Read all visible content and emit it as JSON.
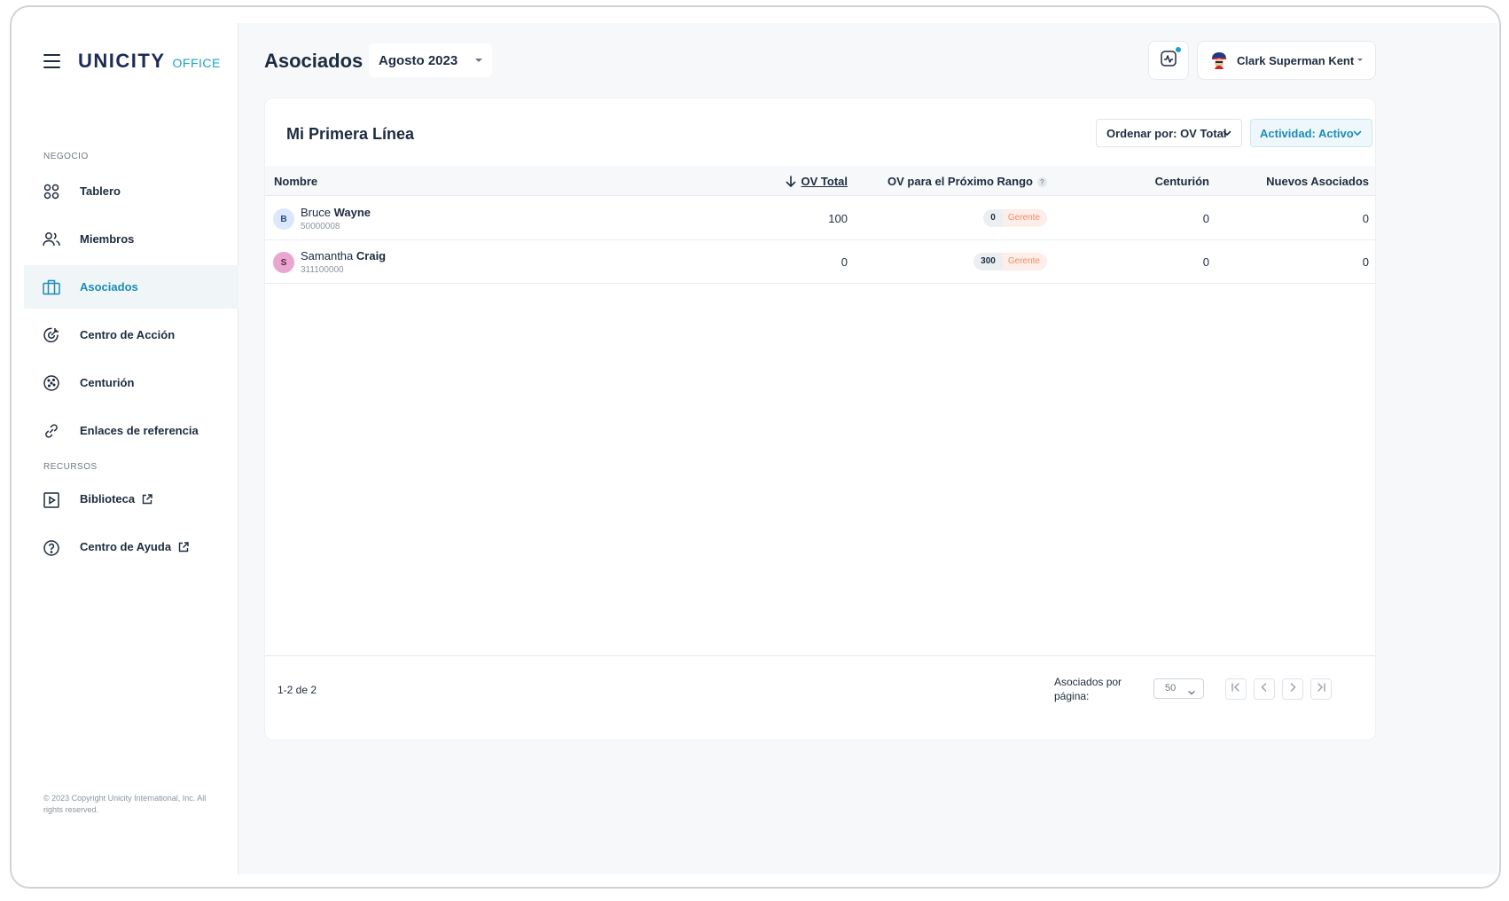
{
  "brand": {
    "name": "UNICITY",
    "product": "OFFICE"
  },
  "sidebar": {
    "sections": [
      {
        "label": "NEGOCIO"
      },
      {
        "label": "RECURSOS"
      }
    ],
    "items": [
      {
        "label": "Tablero",
        "icon": "dashboard-icon"
      },
      {
        "label": "Miembros",
        "icon": "members-icon"
      },
      {
        "label": "Asociados",
        "icon": "briefcase-icon",
        "active": true
      },
      {
        "label": "Centro de Acción",
        "icon": "target-icon"
      },
      {
        "label": "Centurión",
        "icon": "cookie-icon"
      },
      {
        "label": "Enlaces de referencia",
        "icon": "link-icon"
      },
      {
        "label": "Biblioteca",
        "icon": "play-icon",
        "external": true
      },
      {
        "label": "Centro de Ayuda",
        "icon": "help-icon",
        "external": true
      }
    ],
    "copyright": "© 2023 Copyright Unicity International, Inc. All rights reserved."
  },
  "header": {
    "title": "Asociados",
    "period": "Agosto 2023",
    "user_name": "Clark Superman Kent"
  },
  "card": {
    "title": "Mi Primera Línea",
    "sort_label": "Ordenar por: OV Total",
    "filter_label": "Actividad: Activo",
    "columns": {
      "name": "Nombre",
      "ov_total": "OV Total",
      "ov_next_rank": "OV para el Próximo Rango",
      "centurion": "Centurión",
      "new_associates": "Nuevos Asociados"
    },
    "rows": [
      {
        "initial": "B",
        "first": "Bruce",
        "last": "Wayne",
        "id": "50000008",
        "ov_total": "100",
        "ov_next": "0",
        "next_rank": "Gerente",
        "centurion": "0",
        "new_associates": "0",
        "avatar_bg": "#dbe7fb",
        "avatar_fg": "#2d4a8a"
      },
      {
        "initial": "S",
        "first": "Samantha",
        "last": "Craig",
        "id": "311100000",
        "ov_total": "0",
        "ov_next": "300",
        "next_rank": "Gerente",
        "centurion": "0",
        "new_associates": "0",
        "avatar_bg": "#e9a6cf",
        "avatar_fg": "#5a2448"
      }
    ],
    "footer": {
      "range": "1-2 de 2",
      "per_page_label": "Asociados por página:",
      "per_page_value": "50"
    }
  },
  "colors": {
    "accent": "#1aa3c9",
    "active_text": "#1a8cb8",
    "rank_label": "#f08c6a"
  }
}
